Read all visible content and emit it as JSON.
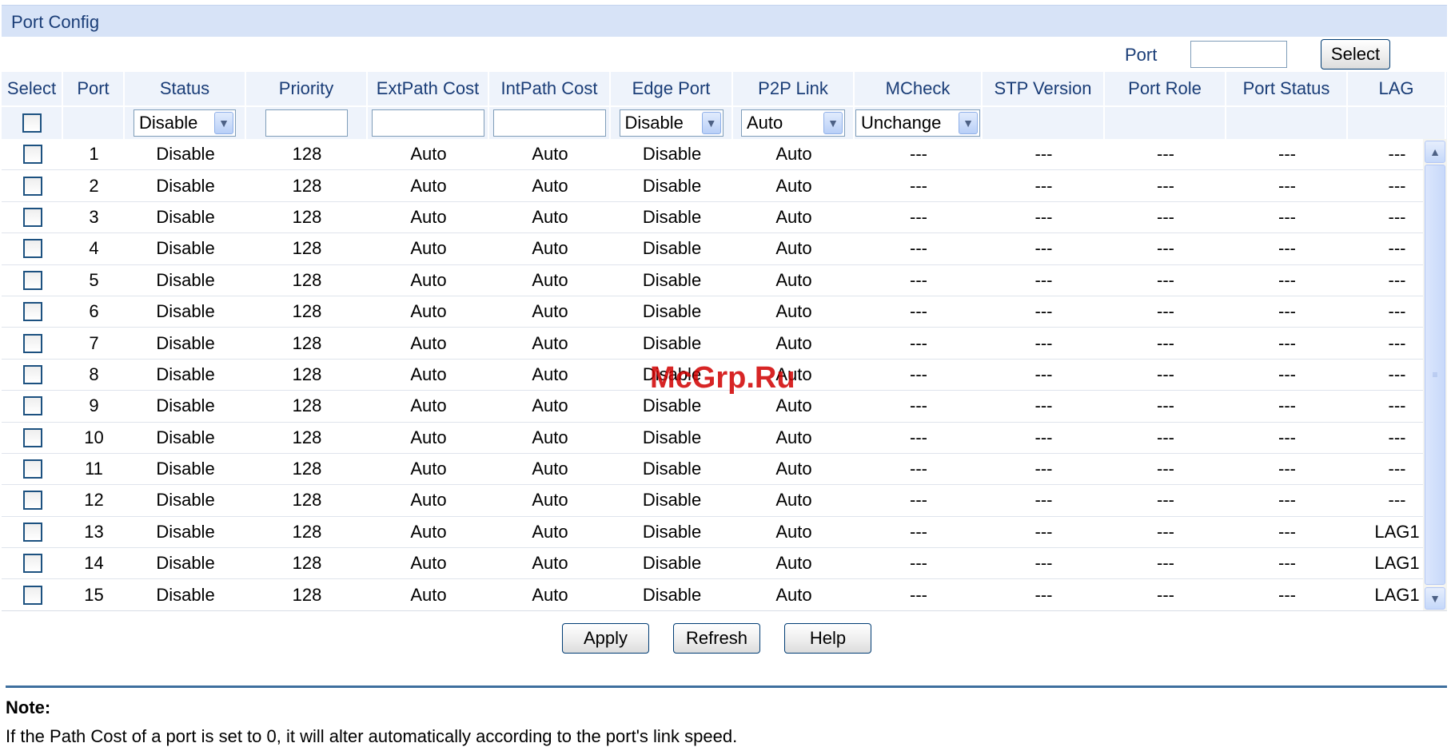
{
  "panel": {
    "title": "Port Config"
  },
  "port_search": {
    "label": "Port",
    "value": "",
    "select_button": "Select"
  },
  "columns": [
    "Select",
    "Port",
    "Status",
    "Priority",
    "ExtPath Cost",
    "IntPath Cost",
    "Edge Port",
    "P2P Link",
    "MCheck",
    "STP Version",
    "Port Role",
    "Port Status",
    "LAG"
  ],
  "filters": {
    "status": "Disable",
    "priority": "",
    "ext_path_cost": "",
    "int_path_cost": "",
    "edge_port": "Disable",
    "p2p_link": "Auto",
    "mcheck": "Unchange"
  },
  "rows": [
    {
      "port": "1",
      "status": "Disable",
      "priority": "128",
      "ext": "Auto",
      "int": "Auto",
      "edge": "Disable",
      "p2p": "Auto",
      "mcheck": "---",
      "stp": "---",
      "role": "---",
      "pstatus": "---",
      "lag": "---"
    },
    {
      "port": "2",
      "status": "Disable",
      "priority": "128",
      "ext": "Auto",
      "int": "Auto",
      "edge": "Disable",
      "p2p": "Auto",
      "mcheck": "---",
      "stp": "---",
      "role": "---",
      "pstatus": "---",
      "lag": "---"
    },
    {
      "port": "3",
      "status": "Disable",
      "priority": "128",
      "ext": "Auto",
      "int": "Auto",
      "edge": "Disable",
      "p2p": "Auto",
      "mcheck": "---",
      "stp": "---",
      "role": "---",
      "pstatus": "---",
      "lag": "---"
    },
    {
      "port": "4",
      "status": "Disable",
      "priority": "128",
      "ext": "Auto",
      "int": "Auto",
      "edge": "Disable",
      "p2p": "Auto",
      "mcheck": "---",
      "stp": "---",
      "role": "---",
      "pstatus": "---",
      "lag": "---"
    },
    {
      "port": "5",
      "status": "Disable",
      "priority": "128",
      "ext": "Auto",
      "int": "Auto",
      "edge": "Disable",
      "p2p": "Auto",
      "mcheck": "---",
      "stp": "---",
      "role": "---",
      "pstatus": "---",
      "lag": "---"
    },
    {
      "port": "6",
      "status": "Disable",
      "priority": "128",
      "ext": "Auto",
      "int": "Auto",
      "edge": "Disable",
      "p2p": "Auto",
      "mcheck": "---",
      "stp": "---",
      "role": "---",
      "pstatus": "---",
      "lag": "---"
    },
    {
      "port": "7",
      "status": "Disable",
      "priority": "128",
      "ext": "Auto",
      "int": "Auto",
      "edge": "Disable",
      "p2p": "Auto",
      "mcheck": "---",
      "stp": "---",
      "role": "---",
      "pstatus": "---",
      "lag": "---"
    },
    {
      "port": "8",
      "status": "Disable",
      "priority": "128",
      "ext": "Auto",
      "int": "Auto",
      "edge": "Disable",
      "p2p": "Auto",
      "mcheck": "---",
      "stp": "---",
      "role": "---",
      "pstatus": "---",
      "lag": "---"
    },
    {
      "port": "9",
      "status": "Disable",
      "priority": "128",
      "ext": "Auto",
      "int": "Auto",
      "edge": "Disable",
      "p2p": "Auto",
      "mcheck": "---",
      "stp": "---",
      "role": "---",
      "pstatus": "---",
      "lag": "---"
    },
    {
      "port": "10",
      "status": "Disable",
      "priority": "128",
      "ext": "Auto",
      "int": "Auto",
      "edge": "Disable",
      "p2p": "Auto",
      "mcheck": "---",
      "stp": "---",
      "role": "---",
      "pstatus": "---",
      "lag": "---"
    },
    {
      "port": "11",
      "status": "Disable",
      "priority": "128",
      "ext": "Auto",
      "int": "Auto",
      "edge": "Disable",
      "p2p": "Auto",
      "mcheck": "---",
      "stp": "---",
      "role": "---",
      "pstatus": "---",
      "lag": "---"
    },
    {
      "port": "12",
      "status": "Disable",
      "priority": "128",
      "ext": "Auto",
      "int": "Auto",
      "edge": "Disable",
      "p2p": "Auto",
      "mcheck": "---",
      "stp": "---",
      "role": "---",
      "pstatus": "---",
      "lag": "---"
    },
    {
      "port": "13",
      "status": "Disable",
      "priority": "128",
      "ext": "Auto",
      "int": "Auto",
      "edge": "Disable",
      "p2p": "Auto",
      "mcheck": "---",
      "stp": "---",
      "role": "---",
      "pstatus": "---",
      "lag": "LAG1"
    },
    {
      "port": "14",
      "status": "Disable",
      "priority": "128",
      "ext": "Auto",
      "int": "Auto",
      "edge": "Disable",
      "p2p": "Auto",
      "mcheck": "---",
      "stp": "---",
      "role": "---",
      "pstatus": "---",
      "lag": "LAG1"
    },
    {
      "port": "15",
      "status": "Disable",
      "priority": "128",
      "ext": "Auto",
      "int": "Auto",
      "edge": "Disable",
      "p2p": "Auto",
      "mcheck": "---",
      "stp": "---",
      "role": "---",
      "pstatus": "---",
      "lag": "LAG1"
    }
  ],
  "actions": {
    "apply": "Apply",
    "refresh": "Refresh",
    "help": "Help"
  },
  "note": {
    "title": "Note:",
    "text": "If the Path Cost of a port is set to 0, it will alter automatically according to the port's link speed."
  },
  "watermark": "McGrp.Ru",
  "icons": {
    "dropdown": "chevron-down-icon",
    "scroll_up": "scroll-up-icon",
    "scroll_down": "scroll-down-icon"
  }
}
